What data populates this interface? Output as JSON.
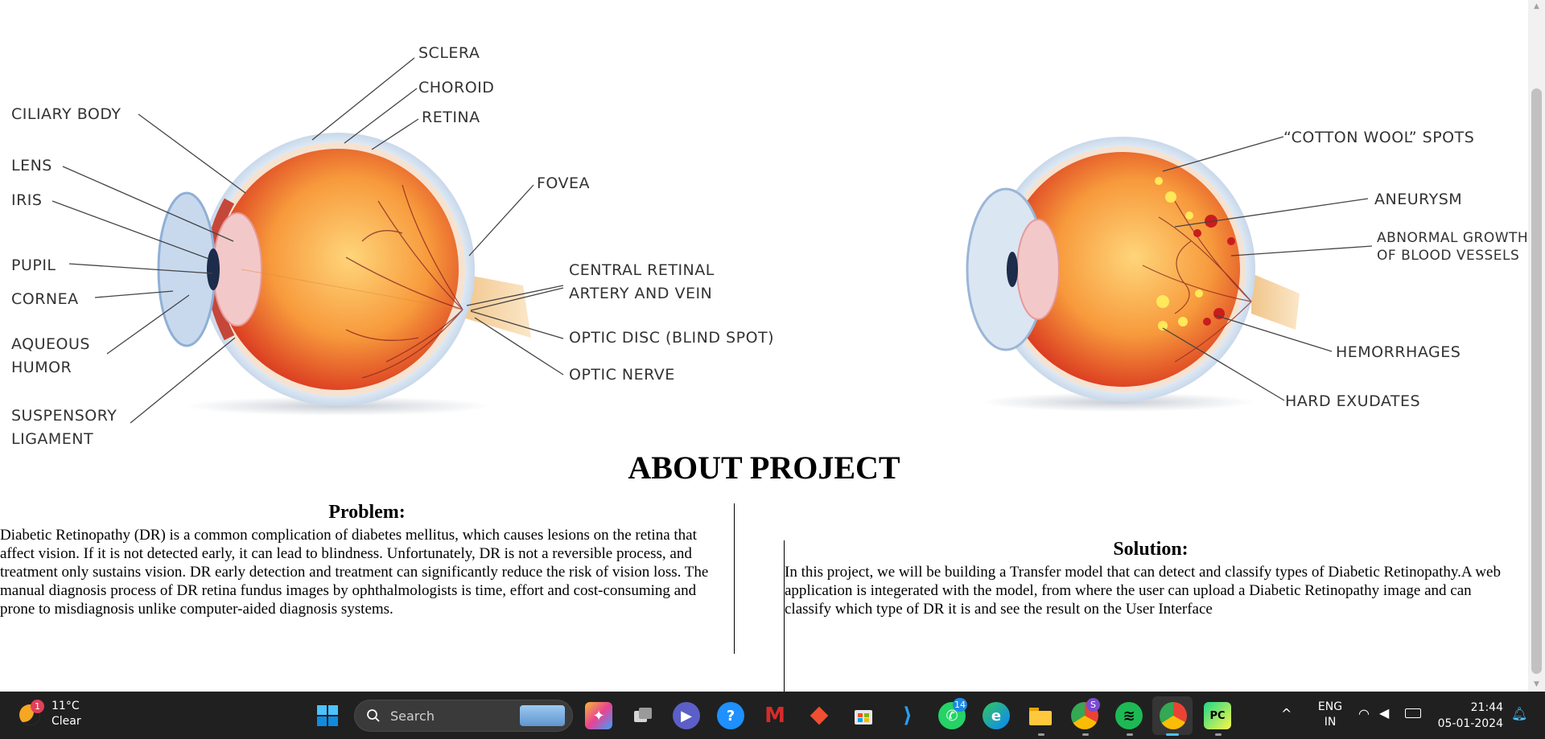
{
  "diagram": {
    "normal_eye_labels": {
      "sclera": "SCLERA",
      "choroid": "CHOROID",
      "retina": "RETINA",
      "ciliary_body": "CILIARY BODY",
      "lens": "LENS",
      "iris": "IRIS",
      "fovea": "FOVEA",
      "pupil": "PUPIL",
      "cornea": "CORNEA",
      "central_retinal_1": "CENTRAL RETINAL",
      "central_retinal_2": "ARTERY AND VEIN",
      "aqueous_1": "AQUEOUS",
      "aqueous_2": "HUMOR",
      "optic_disc": "OPTIC DISC (BLIND SPOT)",
      "optic_nerve": "OPTIC NERVE",
      "suspensory_1": "SUSPENSORY",
      "suspensory_2": "LIGAMENT"
    },
    "dr_eye_labels": {
      "cotton_wool": "“COTTON WOOL” SPOTS",
      "aneurysm": "ANEURYSM",
      "abnormal_1": "ABNORMAL GROWTH",
      "abnormal_2": "OF BLOOD VESSELS",
      "hemorrhages": "HEMORRHAGES",
      "hard_exudates": "HARD EXUDATES"
    }
  },
  "about": {
    "heading": "ABOUT PROJECT",
    "problem_title": "Problem:",
    "problem_text": "Diabetic Retinopathy (DR) is a common complication of diabetes mellitus, which causes lesions on the retina that affect vision. If it is not detected early, it can lead to blindness. Unfortunately, DR is not a reversible process, and treatment only sustains vision. DR early detection and treatment can significantly reduce the risk of vision loss. The manual diagnosis process of DR retina fundus images by ophthalmologists is time, effort and cost-consuming and prone to misdiagnosis unlike computer-aided diagnosis systems.",
    "solution_title": "Solution:",
    "solution_text": "In this project, we will be building a Transfer model that can detect and classify types of Diabetic Retinopathy.A web application is integerated with the model, from where the user can upload a Diabetic Retinopathy image and can classify which type of DR it is and see the result on the User Interface"
  },
  "taskbar": {
    "weather_temp": "11°C",
    "weather_cond": "Clear",
    "weather_badge": "1",
    "search_placeholder": "Search",
    "whatsapp_badge": "14",
    "chrome_profile_badge": "S",
    "lang_1": "ENG",
    "lang_2": "IN",
    "time": "21:44",
    "date": "05-01-2024",
    "apps": [
      "start-icon",
      "search",
      "copilot-icon",
      "task-view-icon",
      "teams-icon",
      "feedback-icon",
      "mcafee-icon",
      "git-icon",
      "store-icon",
      "vscode-icon",
      "whatsapp-icon",
      "edge-icon",
      "file-explorer-icon",
      "chrome-icon",
      "spotify-icon",
      "chrome-active-icon",
      "pycharm-icon"
    ]
  },
  "colors": {
    "taskbar_bg": "#202020",
    "accent_blue": "#0067c0"
  }
}
